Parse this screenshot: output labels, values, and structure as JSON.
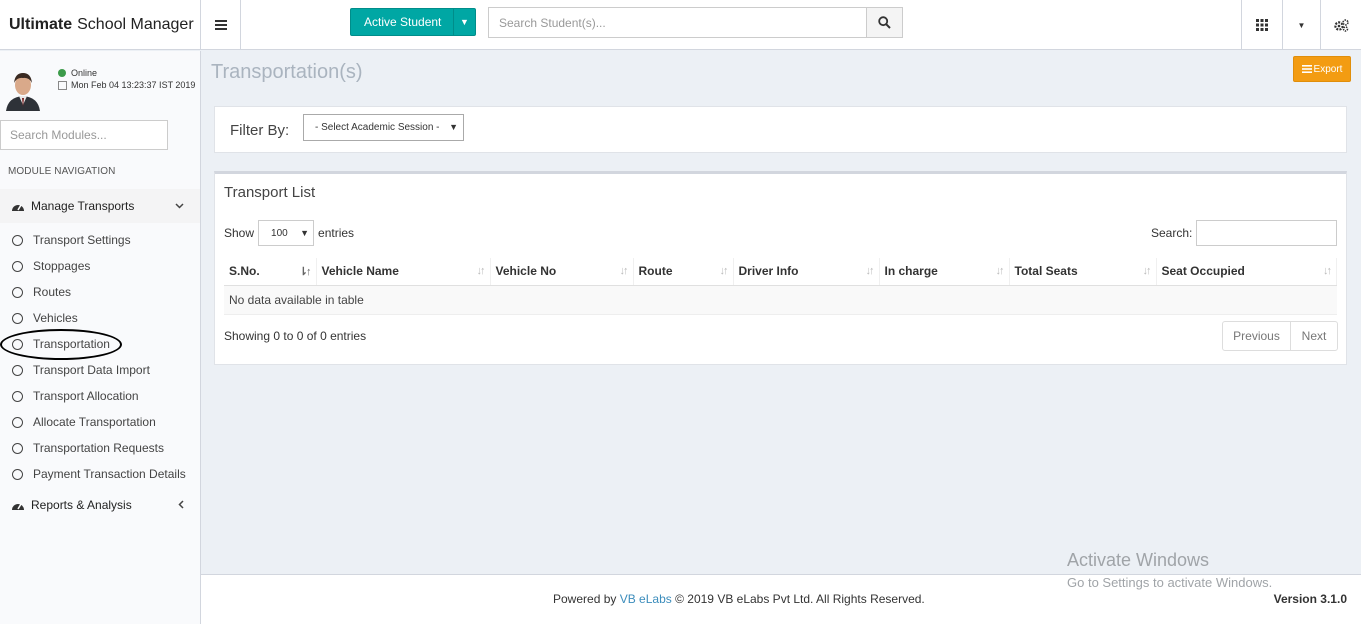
{
  "header": {
    "brand_bold": "Ultimate",
    "brand_rest": "School Manager",
    "active_student_label": "Active Student",
    "search_placeholder": "Search Student(s)..."
  },
  "sidebar": {
    "status": "Online",
    "datetime": "Mon Feb 04 13:23:37 IST 2019",
    "search_placeholder": "Search Modules...",
    "nav_heading": "MODULE NAVIGATION",
    "section_manage": "Manage Transports",
    "items": [
      {
        "label": "Transport Settings"
      },
      {
        "label": "Stoppages"
      },
      {
        "label": "Routes"
      },
      {
        "label": "Vehicles"
      },
      {
        "label": "Transportation"
      },
      {
        "label": "Transport Data Import"
      },
      {
        "label": "Transport Allocation"
      },
      {
        "label": "Allocate Transportation"
      },
      {
        "label": "Transportation Requests"
      },
      {
        "label": "Payment Transaction Details"
      }
    ],
    "section_reports": "Reports & Analysis"
  },
  "main": {
    "page_title": "Transportation(s)",
    "export_label": "Export",
    "filter_label": "Filter By:",
    "session_select": "- Select Academic Session -",
    "list_title": "Transport List",
    "show_label": "Show",
    "entries_label": "entries",
    "page_length": "100",
    "search_label": "Search:",
    "columns": [
      "S.No.",
      "Vehicle Name",
      "Vehicle No",
      "Route",
      "Driver Info",
      "In charge",
      "Total Seats",
      "Seat Occupied"
    ],
    "empty_message": "No data available in table",
    "showing_text": "Showing 0 to 0 of 0 entries",
    "prev_label": "Previous",
    "next_label": "Next"
  },
  "footer": {
    "powered_by": "Powered by",
    "company_link": "VB eLabs",
    "copyright": "© 2019 VB eLabs Pvt Ltd. All Rights Reserved.",
    "version": "Version 3.1.0"
  },
  "watermark": {
    "line1": "Activate Windows",
    "line2": "Go to Settings to activate Windows."
  },
  "colors": {
    "active_student_bg": "#00a7a4",
    "export_bg": "#f39c12",
    "link": "#3c8dbc",
    "online_dot": "#3c9b4a"
  }
}
